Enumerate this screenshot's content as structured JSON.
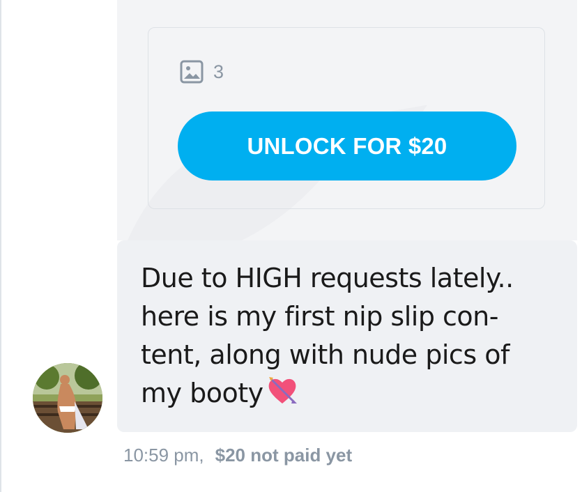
{
  "media": {
    "icon": "image-icon",
    "count": "3",
    "unlock_label": "UNLOCK FOR $20"
  },
  "message": {
    "text": "Due to HIGH requests lately.. here is my first nip slip con-tent, along with nude pics of my booty",
    "line1": "Due to HIGH requests lately..",
    "line2": "here is my first nip slip con-",
    "line3": "tent, along with nude pics of",
    "line4": "my booty",
    "emoji": "heart-with-arrow-icon"
  },
  "meta": {
    "time": "10:59 pm,",
    "price_status": "$20 not paid yet"
  },
  "colors": {
    "accent": "#00aff0",
    "bubble": "#eff1f4",
    "muted": "#8a96a3"
  }
}
